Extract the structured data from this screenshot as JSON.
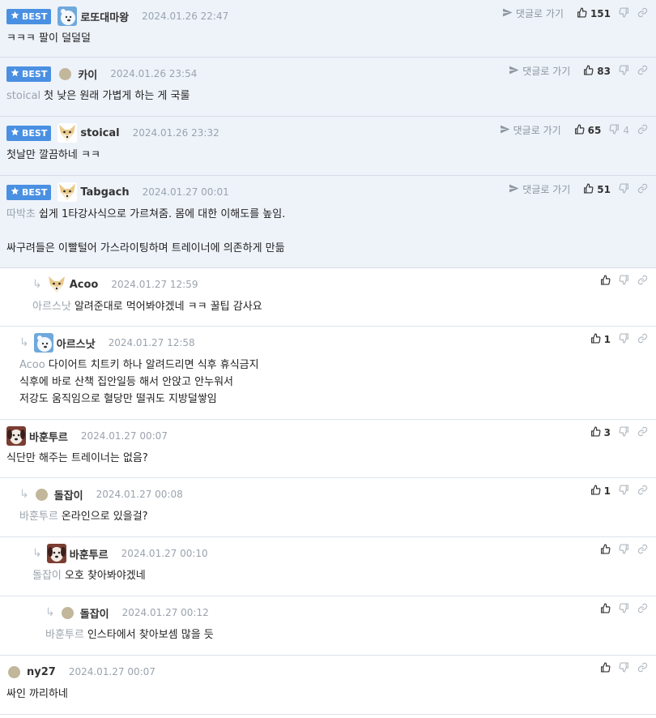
{
  "labels": {
    "best": "BEST",
    "goto_reply": "댓글로 가기"
  },
  "colors": {
    "best_badge": "#4a90e2",
    "best_bg": "#eef3fa",
    "muted_text": "#9aa3ad"
  },
  "comments": [
    {
      "best": true,
      "indent": 0,
      "avatar": "polar-bear-avatar",
      "nick": "로또대마왕",
      "date": "2024.01.26 22:47",
      "reply_to": "",
      "lines": [
        "ㅋㅋㅋ 팔이 덜덜덜"
      ],
      "goto_reply": true,
      "up": "151",
      "down": ""
    },
    {
      "best": true,
      "indent": 0,
      "avatar": "default-dot-avatar",
      "nick": "카이",
      "date": "2024.01.26 23:54",
      "reply_to": "stoical",
      "lines": [
        "첫 낮은 원래 가볍게 하는 게 국룰"
      ],
      "goto_reply": true,
      "up": "83",
      "down": ""
    },
    {
      "best": true,
      "indent": 0,
      "avatar": "fox-avatar",
      "nick": "stoical",
      "date": "2024.01.26 23:32",
      "reply_to": "",
      "lines": [
        "첫날만 깔끔하네 ㅋㅋ"
      ],
      "goto_reply": true,
      "up": "65",
      "down": "4"
    },
    {
      "best": true,
      "indent": 0,
      "avatar": "fox-avatar",
      "nick": "Tabgach",
      "date": "2024.01.27 00:01",
      "reply_to": "따박초",
      "lines": [
        "쉽게 1타강사식으로 가르쳐줌. 몸에 대한 이해도를 높임.",
        "",
        "싸구려들은 이빨털어 가스라이팅하며 트레이너에 의존하게 만듦"
      ],
      "goto_reply": true,
      "up": "51",
      "down": ""
    },
    {
      "best": false,
      "indent": 2,
      "avatar": "fox-avatar",
      "nick": "Acoo",
      "date": "2024.01.27 12:59",
      "reply_to": "아르스낫",
      "lines": [
        "알려준대로 먹어봐야겠네 ㅋㅋ 꿀팁 감사요"
      ],
      "goto_reply": false,
      "up": "",
      "down": ""
    },
    {
      "best": false,
      "indent": 1,
      "avatar": "polar-bear-avatar",
      "nick": "아르스낫",
      "date": "2024.01.27 12:58",
      "reply_to": "Acoo",
      "lines": [
        "다이어트 치트키 하나 알려드리면 식후 휴식금지",
        "식후에 바로 산책 집안일등 해서 안앉고 안누워서",
        "저강도 움직임으로 혈당만 떨궈도 지방덜쌓임"
      ],
      "goto_reply": false,
      "up": "1",
      "down": ""
    },
    {
      "best": false,
      "indent": 0,
      "avatar": "dog-avatar",
      "nick": "바훈투르",
      "date": "2024.01.27 00:07",
      "reply_to": "",
      "lines": [
        "식단만 해주는 트레이너는 없음?"
      ],
      "goto_reply": false,
      "up": "3",
      "down": ""
    },
    {
      "best": false,
      "indent": 1,
      "avatar": "default-dot-avatar",
      "nick": "돌잡이",
      "date": "2024.01.27 00:08",
      "reply_to": "바훈투르",
      "lines": [
        "온라인으로 있을걸?"
      ],
      "goto_reply": false,
      "up": "1",
      "down": ""
    },
    {
      "best": false,
      "indent": 2,
      "avatar": "dog-avatar",
      "nick": "바훈투르",
      "date": "2024.01.27 00:10",
      "reply_to": "돌잡이",
      "lines": [
        "오호 찾아봐야겠네"
      ],
      "goto_reply": false,
      "up": "",
      "down": ""
    },
    {
      "best": false,
      "indent": 3,
      "avatar": "default-dot-avatar",
      "nick": "돌잡이",
      "date": "2024.01.27 00:12",
      "reply_to": "바훈투르",
      "lines": [
        "인스타에서 찾아보셈 많을 듯"
      ],
      "goto_reply": false,
      "up": "",
      "down": ""
    },
    {
      "best": false,
      "indent": 0,
      "avatar": "default-dot-avatar",
      "nick": "ny27",
      "date": "2024.01.27 00:07",
      "reply_to": "",
      "lines": [
        "싸인 까리하네"
      ],
      "goto_reply": false,
      "up": "",
      "down": ""
    }
  ]
}
